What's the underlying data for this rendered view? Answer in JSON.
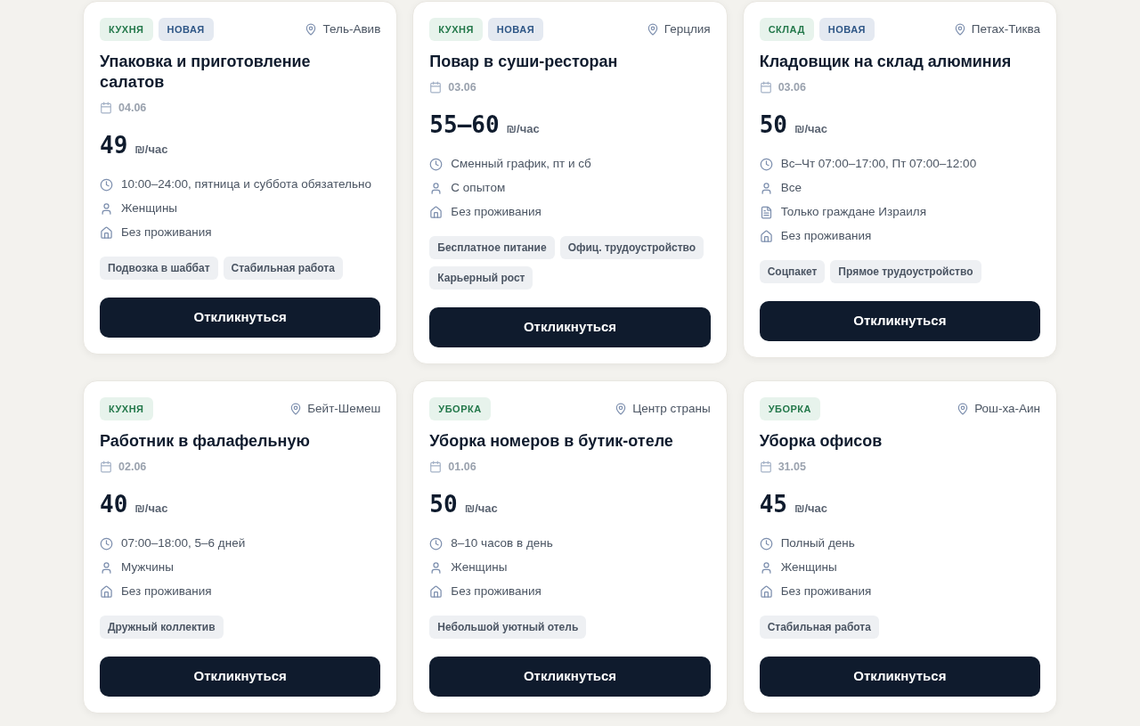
{
  "vacancies": [
    {
      "tags": [
        {
          "label": "КУХНЯ",
          "kind": "category"
        },
        {
          "label": "НОВАЯ",
          "kind": "new"
        }
      ],
      "location": "Тель-Авив",
      "title": "Упаковка и приготовление салатов",
      "date": "04.06",
      "pay": "49",
      "pay_unit": "₪/час",
      "details": [
        {
          "kind": "schedule",
          "text": "10:00–24:00, пятница и суббота обязательно"
        },
        {
          "kind": "gender",
          "text": "Женщины"
        },
        {
          "kind": "housing",
          "text": "Без проживания"
        }
      ],
      "perks": [
        "Подвозка в шаббат",
        "Стабильная работа"
      ],
      "button": "Откликнуться"
    },
    {
      "tags": [
        {
          "label": "КУХНЯ",
          "kind": "category"
        },
        {
          "label": "НОВАЯ",
          "kind": "new"
        }
      ],
      "location": "Герцлия",
      "title": "Повар в суши-ресторан",
      "date": "03.06",
      "pay": "55–60",
      "pay_unit": "₪/час",
      "details": [
        {
          "kind": "schedule",
          "text": "Сменный график, пт и сб"
        },
        {
          "kind": "gender",
          "text": "С опытом"
        },
        {
          "kind": "housing",
          "text": "Без проживания"
        }
      ],
      "perks": [
        "Бесплатное питание",
        "Офиц. трудоустройство",
        "Карьерный рост"
      ],
      "button": "Откликнуться"
    },
    {
      "tags": [
        {
          "label": "СКЛАД",
          "kind": "category"
        },
        {
          "label": "НОВАЯ",
          "kind": "new"
        }
      ],
      "location": "Петах-Тиква",
      "title": "Кладовщик на склад алюминия",
      "date": "03.06",
      "pay": "50",
      "pay_unit": "₪/час",
      "details": [
        {
          "kind": "schedule",
          "text": "Вс–Чт 07:00–17:00, Пт 07:00–12:00"
        },
        {
          "kind": "gender",
          "text": "Все"
        },
        {
          "kind": "document",
          "text": "Только граждане Израиля"
        },
        {
          "kind": "housing",
          "text": "Без проживания"
        }
      ],
      "perks": [
        "Соцпакет",
        "Прямое трудоустройство"
      ],
      "button": "Откликнуться"
    },
    {
      "tags": [
        {
          "label": "КУХНЯ",
          "kind": "category"
        }
      ],
      "location": "Бейт-Шемеш",
      "title": "Работник в фалафельную",
      "date": "02.06",
      "pay": "40",
      "pay_unit": "₪/час",
      "details": [
        {
          "kind": "schedule",
          "text": "07:00–18:00, 5–6 дней"
        },
        {
          "kind": "gender",
          "text": "Мужчины"
        },
        {
          "kind": "housing",
          "text": "Без проживания"
        }
      ],
      "perks": [
        "Дружный коллектив"
      ],
      "button": "Откликнуться"
    },
    {
      "tags": [
        {
          "label": "УБОРКА",
          "kind": "category"
        }
      ],
      "location": "Центр страны",
      "title": "Уборка номеров в бутик-отеле",
      "date": "01.06",
      "pay": "50",
      "pay_unit": "₪/час",
      "details": [
        {
          "kind": "schedule",
          "text": "8–10 часов в день"
        },
        {
          "kind": "gender",
          "text": "Женщины"
        },
        {
          "kind": "housing",
          "text": "Без проживания"
        }
      ],
      "perks": [
        "Небольшой уютный отель"
      ],
      "button": "Откликнуться"
    },
    {
      "tags": [
        {
          "label": "УБОРКА",
          "kind": "category"
        }
      ],
      "location": "Рош-ха-Аин",
      "title": "Уборка офисов",
      "date": "31.05",
      "pay": "45",
      "pay_unit": "₪/час",
      "details": [
        {
          "kind": "schedule",
          "text": "Полный день"
        },
        {
          "kind": "gender",
          "text": "Женщины"
        },
        {
          "kind": "housing",
          "text": "Без проживания"
        }
      ],
      "perks": [
        "Стабильная работа"
      ],
      "button": "Откликнуться"
    }
  ]
}
